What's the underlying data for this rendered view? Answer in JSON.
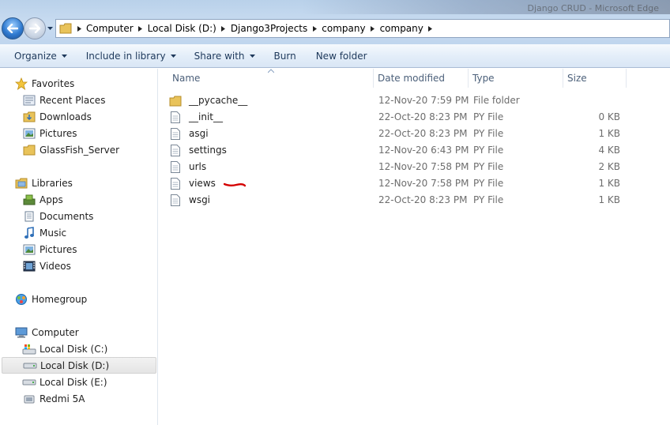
{
  "window": {
    "title": "Django CRUD - Microsoft Edge"
  },
  "address": {
    "crumbs": [
      "Computer",
      "Local Disk (D:)",
      "Django3Projects",
      "company",
      "company"
    ]
  },
  "toolbar": {
    "organize": "Organize",
    "include_in_library": "Include in library",
    "share_with": "Share with",
    "burn": "Burn",
    "new_folder": "New folder"
  },
  "navpane": {
    "favorites": {
      "label": "Favorites",
      "items": [
        "Recent Places",
        "Downloads",
        "Pictures",
        "GlassFish_Server"
      ]
    },
    "libraries": {
      "label": "Libraries",
      "items": [
        "Apps",
        "Documents",
        "Music",
        "Pictures",
        "Videos"
      ]
    },
    "homegroup": {
      "label": "Homegroup"
    },
    "computer": {
      "label": "Computer",
      "items": [
        "Local Disk (C:)",
        "Local Disk (D:)",
        "Local Disk (E:)",
        "Redmi 5A"
      ],
      "selected": "Local Disk (D:)"
    }
  },
  "columns": {
    "name": "Name",
    "date_modified": "Date modified",
    "type": "Type",
    "size": "Size"
  },
  "files": [
    {
      "name": "__pycache__",
      "date": "12-Nov-20 7:59 PM",
      "type": "File folder",
      "size": "",
      "icon": "folder-icon"
    },
    {
      "name": "__init__",
      "date": "22-Oct-20 8:23 PM",
      "type": "PY File",
      "size": "0 KB",
      "icon": "file-icon"
    },
    {
      "name": "asgi",
      "date": "22-Oct-20 8:23 PM",
      "type": "PY File",
      "size": "1 KB",
      "icon": "file-icon"
    },
    {
      "name": "settings",
      "date": "12-Nov-20 6:43 PM",
      "type": "PY File",
      "size": "4 KB",
      "icon": "file-icon"
    },
    {
      "name": "urls",
      "date": "12-Nov-20 7:58 PM",
      "type": "PY File",
      "size": "2 KB",
      "icon": "file-icon"
    },
    {
      "name": "views",
      "date": "12-Nov-20 7:58 PM",
      "type": "PY File",
      "size": "1 KB",
      "icon": "file-icon"
    },
    {
      "name": "wsgi",
      "date": "22-Oct-20 8:23 PM",
      "type": "PY File",
      "size": "1 KB",
      "icon": "file-icon"
    }
  ],
  "colors": {
    "annotation": "#d40000",
    "selection": "#e4e4e4",
    "toolbar_text": "#1e395b"
  }
}
